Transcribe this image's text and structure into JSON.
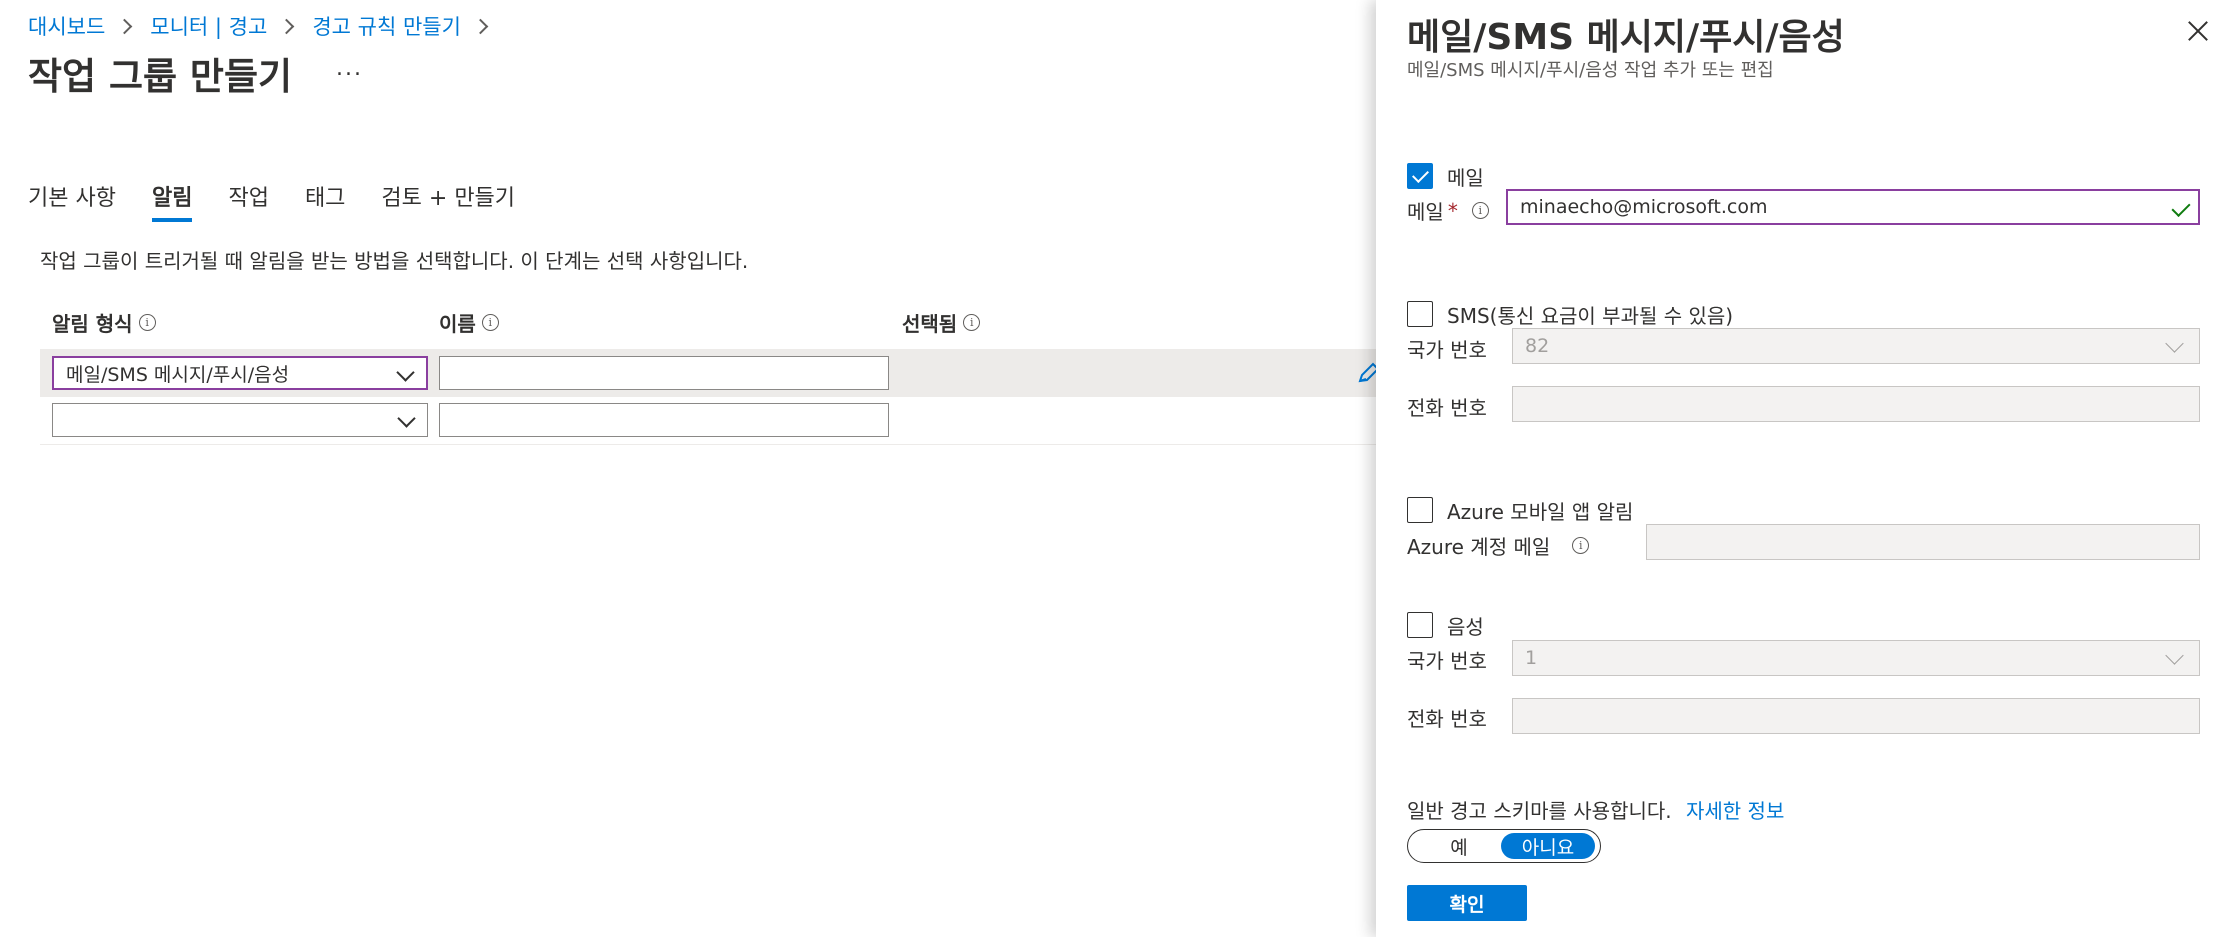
{
  "breadcrumb": [
    "대시보드",
    "모니터 | 경고",
    "경고 규칙 만들기"
  ],
  "page": {
    "title": "작업 그룹 만들기",
    "more": "..."
  },
  "tabs": [
    {
      "label": "기본 사항",
      "active": false
    },
    {
      "label": "알림",
      "active": true
    },
    {
      "label": "작업",
      "active": false
    },
    {
      "label": "태그",
      "active": false
    },
    {
      "label": "검토 + 만들기",
      "active": false
    }
  ],
  "description": "작업 그룹이 트리거될 때 알림을 받는 방법을 선택합니다. 이 단계는 선택 사항입니다.",
  "table": {
    "headers": [
      "알림 형식",
      "이름",
      "선택됨"
    ],
    "rows": [
      {
        "type": "메일/SMS 메시지/푸시/음성",
        "name": ""
      },
      {
        "type": "",
        "name": ""
      }
    ]
  },
  "panel": {
    "title": "메일/SMS 메시지/푸시/음성",
    "subtitle": "메일/SMS 메시지/푸시/음성 작업 추가 또는 편집",
    "email": {
      "checkbox_label": "메일",
      "checked": true,
      "field_label": "메일",
      "required_mark": "*",
      "value": "minaecho@microsoft.com"
    },
    "sms": {
      "checkbox_label": "SMS(통신 요금이 부과될 수 있음)",
      "checked": false,
      "country_label": "국가 번호",
      "country_value": "82",
      "phone_label": "전화 번호",
      "phone_value": ""
    },
    "push": {
      "checkbox_label": "Azure 모바일 앱 알림",
      "checked": false,
      "account_label": "Azure 계정 메일",
      "account_value": ""
    },
    "voice": {
      "checkbox_label": "음성",
      "checked": false,
      "country_label": "국가 번호",
      "country_value": "1",
      "phone_label": "전화 번호",
      "phone_value": ""
    },
    "schema": {
      "text": "일반 경고 스키마를 사용합니다.",
      "link": "자세한 정보",
      "yes": "예",
      "no": "아니요",
      "selected": "아니요"
    },
    "ok_button": "확인"
  },
  "colors": {
    "accent": "#0078d4",
    "focus_border": "#8a3f9f",
    "valid": "#107c10",
    "required": "#a4262c"
  },
  "icons": [
    "chevron-right-icon",
    "chevron-down-icon",
    "info-icon",
    "edit-pencil-icon",
    "close-icon",
    "checkmark-icon"
  ]
}
